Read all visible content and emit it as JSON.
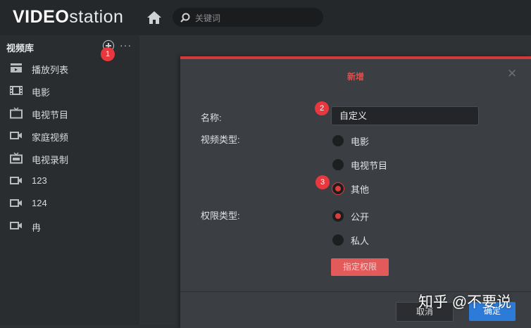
{
  "header": {
    "logo_bold": "VIDEO",
    "logo_light": "station",
    "home_icon": "home-icon",
    "search": {
      "placeholder": "关键词",
      "icon": "search-icon"
    }
  },
  "sidebar": {
    "header_label": "视频库",
    "add_icon": "plus-circle-icon",
    "more_label": "···",
    "items": [
      {
        "label": "播放列表",
        "icon": "playlist-icon"
      },
      {
        "label": "电影",
        "icon": "film-icon"
      },
      {
        "label": "电视节目",
        "icon": "tv-icon"
      },
      {
        "label": "家庭视频",
        "icon": "camera-icon"
      },
      {
        "label": "电视录制",
        "icon": "tv-rec-icon"
      },
      {
        "label": "123",
        "icon": "camera-icon"
      },
      {
        "label": "124",
        "icon": "camera-icon"
      },
      {
        "label": "冉",
        "icon": "camera-icon"
      }
    ]
  },
  "dialog": {
    "title": "新增",
    "close_label": "✕",
    "name_label": "名称:",
    "name_value": "自定义",
    "video_type_label": "视频类型:",
    "video_types": [
      {
        "label": "电影",
        "selected": false
      },
      {
        "label": "电视节目",
        "selected": false
      },
      {
        "label": "其他",
        "selected": true
      }
    ],
    "permission_label": "权限类型:",
    "permission_types": [
      {
        "label": "公开",
        "selected": true
      },
      {
        "label": "私人",
        "selected": false
      }
    ],
    "assign_button": "指定权限",
    "cancel_button": "取消",
    "ok_button": "确定"
  },
  "annotations": [
    "1",
    "2",
    "3"
  ],
  "watermark": "知乎 @不要说",
  "colors": {
    "accent_red": "#e03c3c",
    "ok_blue": "#2d7bd8",
    "badge_red": "#e8383d"
  }
}
